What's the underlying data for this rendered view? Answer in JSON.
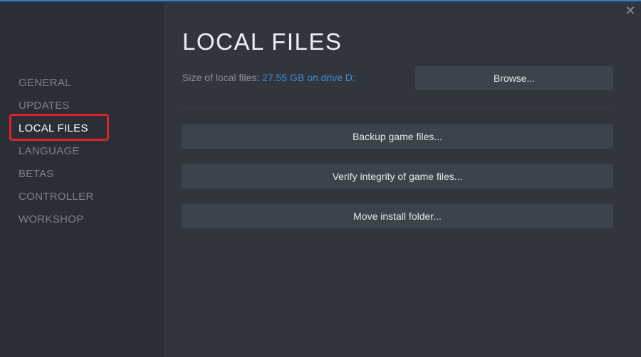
{
  "window": {
    "close_glyph": "✕"
  },
  "sidebar": {
    "items": [
      {
        "label": "GENERAL",
        "active": false
      },
      {
        "label": "UPDATES",
        "active": false
      },
      {
        "label": "LOCAL FILES",
        "active": true
      },
      {
        "label": "LANGUAGE",
        "active": false
      },
      {
        "label": "BETAS",
        "active": false
      },
      {
        "label": "CONTROLLER",
        "active": false
      },
      {
        "label": "WORKSHOP",
        "active": false
      }
    ]
  },
  "main": {
    "title": "LOCAL FILES",
    "size_label": "Size of local files:",
    "size_value": "27.55 GB on drive D:",
    "browse_label": "Browse...",
    "actions": {
      "backup_label": "Backup game files...",
      "verify_label": "Verify integrity of game files...",
      "move_label": "Move install folder..."
    }
  },
  "colors": {
    "accent_link": "#3e8ed6",
    "highlight_box": "#e0202a",
    "sidebar_bg": "#2a2e36",
    "content_bg": "#31353d",
    "button_bg": "#3d434c"
  },
  "icons": {
    "close": "close-icon"
  }
}
